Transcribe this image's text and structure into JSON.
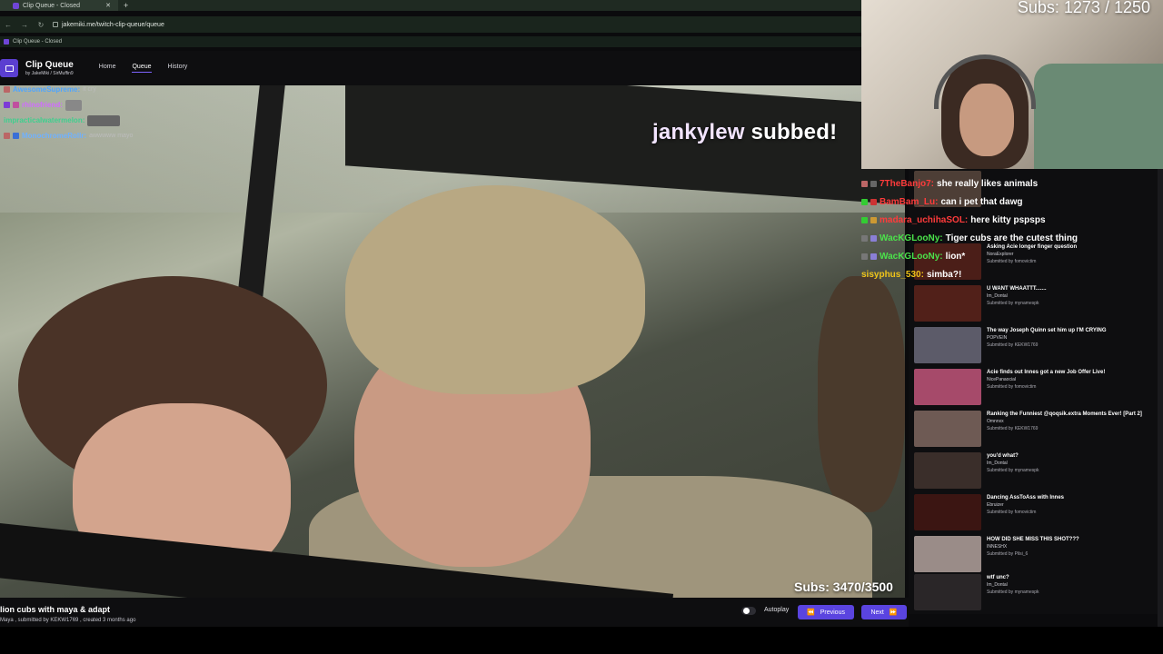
{
  "browser": {
    "tab_title": "Clip Queue - Closed",
    "new_tab": "+",
    "url": "jakemiki.me/twitch-clip-queue/queue",
    "bookmark": "Clip Queue - Closed"
  },
  "app": {
    "title": "Clip Queue",
    "subtitle": "by JakeMiki / SirMuffin9",
    "nav": [
      "Home",
      "Queue",
      "History"
    ]
  },
  "overlay": {
    "sub_alert_name": "jankylew",
    "sub_alert_rest": "subbed!",
    "subs_bottom": "Subs: 3470/3500",
    "webcam_subs": "Subs: 1273 / 1250"
  },
  "left_chat": [
    {
      "name": "AwesomeSupreme:",
      "msg": "it cry",
      "color": "#4ea5ff"
    },
    {
      "name": "rhinofriend:",
      "msg": "",
      "color": "#d16bff"
    },
    {
      "name": "impracticalwatermelon:",
      "msg": "",
      "color": "#3fcf8e"
    },
    {
      "name": "MonochromeRollr:",
      "msg": "awwwww mayo",
      "color": "#6fb1ff"
    }
  ],
  "right_chat": [
    {
      "name": "7TheBanjo7:",
      "msg": "she really likes animals",
      "color": "#ff3b3b"
    },
    {
      "name": "BamBam_Lu:",
      "msg": "can i pet that dawg",
      "color": "#ff3b3b"
    },
    {
      "name": "madara_uchihaSOL:",
      "msg": "here kitty pspsps",
      "color": "#ff3b3b"
    },
    {
      "name": "WacKGLooNy:",
      "msg": "Tiger cubs are the cutest thing",
      "color": "#4be34b"
    },
    {
      "name": "WacKGLooNy:",
      "msg": "lion*",
      "color": "#4be34b"
    },
    {
      "name": "sisyphus_530:",
      "msg": "simba?!",
      "color": "#f0c419"
    }
  ],
  "queue": [
    {
      "title": "Asking Acie longer finger question",
      "author": "NoraExplorer",
      "submitted": "Submitted by fomovictim"
    },
    {
      "title": "U WANT WHAATTT.......",
      "author": "Im_Dontal",
      "submitted": "Submitted by mynamespk"
    },
    {
      "title": "The way Joseph Quinn set him up I'M CRYING",
      "author": "POPVEIN",
      "submitted": "Submitted by KEKW1769"
    },
    {
      "title": "Acie finds out Innes got a new Job Offer Live!",
      "author": "NicePanaocial",
      "submitted": "Submitted by fomovictim"
    },
    {
      "title": "Ranking the Funniest @qoqsik.extra Moments Ever! [Part 2]",
      "author": "Omnnxx",
      "submitted": "Submitted by KEKW1769"
    },
    {
      "title": "you'd what?",
      "author": "Im_Dontal",
      "submitted": "Submitted by mynamespk"
    },
    {
      "title": "Dancing AssToAss with Innes",
      "author": "Ebruizer",
      "submitted": "Submitted by fomovictim"
    },
    {
      "title": "HOW DID SHE MISS THIS SHOT???",
      "author": "INNESHX",
      "submitted": "Submitted by Pilsi_6"
    },
    {
      "title": "wtf unc?",
      "author": "Im_Dontal",
      "submitted": "Submitted by mynamespk"
    }
  ],
  "footer": {
    "clip_title": "lion cubs with maya & adapt",
    "clip_meta": "Maya , submitted by KEKW1769 , created 3 months ago",
    "autoplay": "Autoplay",
    "prev": "Previous",
    "next": "Next"
  },
  "colors": {
    "accent": "#5a44e0",
    "panel": "#0e0e10"
  }
}
